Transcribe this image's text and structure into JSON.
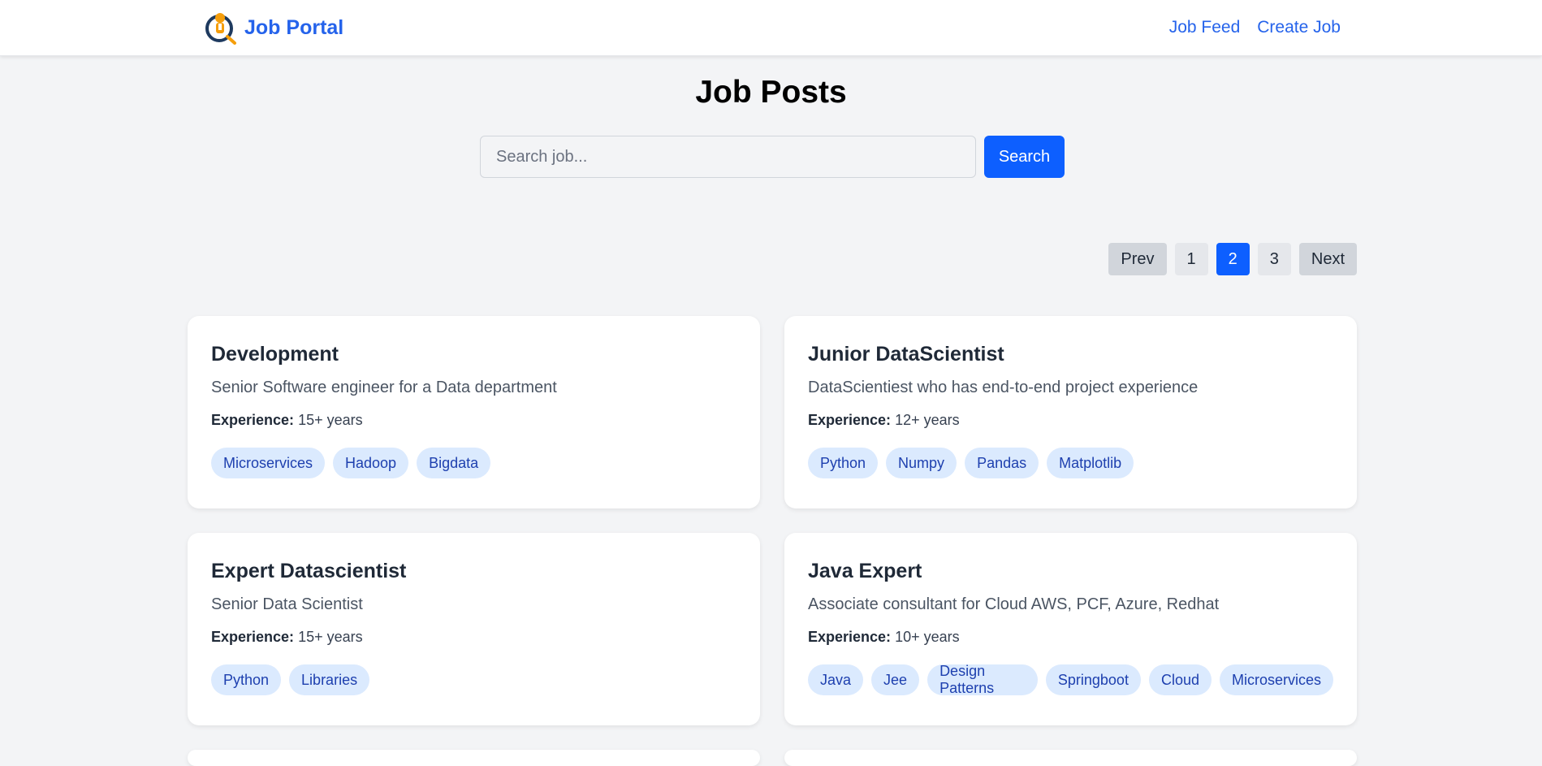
{
  "header": {
    "brand_name": "Job Portal",
    "nav": [
      {
        "label": "Job Feed"
      },
      {
        "label": "Create Job"
      }
    ]
  },
  "page": {
    "title": "Job Posts"
  },
  "search": {
    "placeholder": "Search job...",
    "value": "",
    "button_label": "Search"
  },
  "pagination": {
    "prev_label": "Prev",
    "next_label": "Next",
    "pages": [
      "1",
      "2",
      "3"
    ],
    "current_page": "2"
  },
  "jobs": [
    {
      "title": "Development",
      "description": "Senior Software engineer for a Data department",
      "experience_label": "Experience:",
      "experience": "15+ years",
      "tags": [
        "Microservices",
        "Hadoop",
        "Bigdata"
      ]
    },
    {
      "title": "Junior DataScientist",
      "description": "DataScientiest who has end-to-end project experience",
      "experience_label": "Experience:",
      "experience": "12+ years",
      "tags": [
        "Python",
        "Numpy",
        "Pandas",
        "Matplotlib"
      ]
    },
    {
      "title": "Expert Datascientist",
      "description": "Senior Data Scientist",
      "experience_label": "Experience:",
      "experience": "15+ years",
      "tags": [
        "Python",
        "Libraries"
      ]
    },
    {
      "title": "Java Expert",
      "description": "Associate consultant for Cloud AWS, PCF, Azure, Redhat",
      "experience_label": "Experience:",
      "experience": "10+ years",
      "tags": [
        "Java",
        "Jee",
        "Design Patterns",
        "Springboot",
        "Cloud",
        "Microservices"
      ]
    }
  ],
  "colors": {
    "primary": "#0d5fff",
    "link": "#2563eb",
    "tag_bg": "#dbeafe",
    "tag_text": "#1e40af",
    "page_bg": "#f3f4f6"
  }
}
